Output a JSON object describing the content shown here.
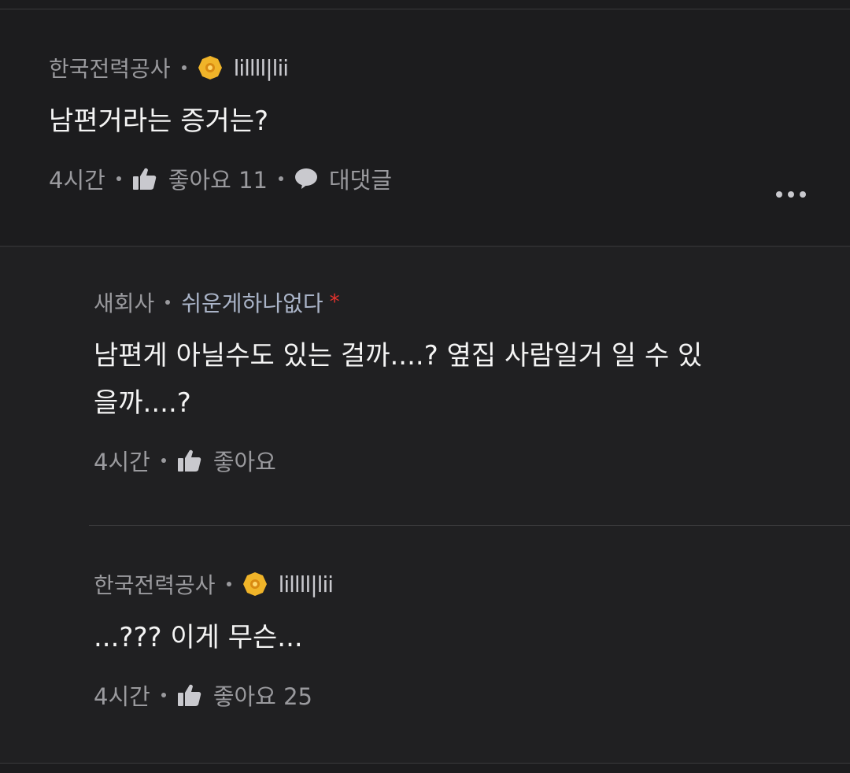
{
  "comments": [
    {
      "company": "한국전력공사",
      "badge_icon": "gold-badge-icon",
      "nickname": "lillll|lii",
      "body": "남편거라는 증거는?",
      "time": "4시간",
      "like_label": "좋아요 11",
      "reply_label": "대댓글"
    },
    {
      "company": "새회사",
      "nickname": "쉬운게하나없다",
      "star": "*",
      "body": "남편게 아닐수도 있는 걸까....? 옆집 사람일거 일 수 있\n을까....?",
      "time": "4시간",
      "like_label": "좋아요"
    },
    {
      "company": "한국전력공사",
      "badge_icon": "gold-badge-icon",
      "nickname": "lillll|lii",
      "body": "...??? 이게 무슨...",
      "time": "4시간",
      "like_label": "좋아요 25"
    }
  ],
  "colors": {
    "background": "#1c1c1e",
    "badge_gold": "#f0b429",
    "star_red": "#e5322d"
  }
}
